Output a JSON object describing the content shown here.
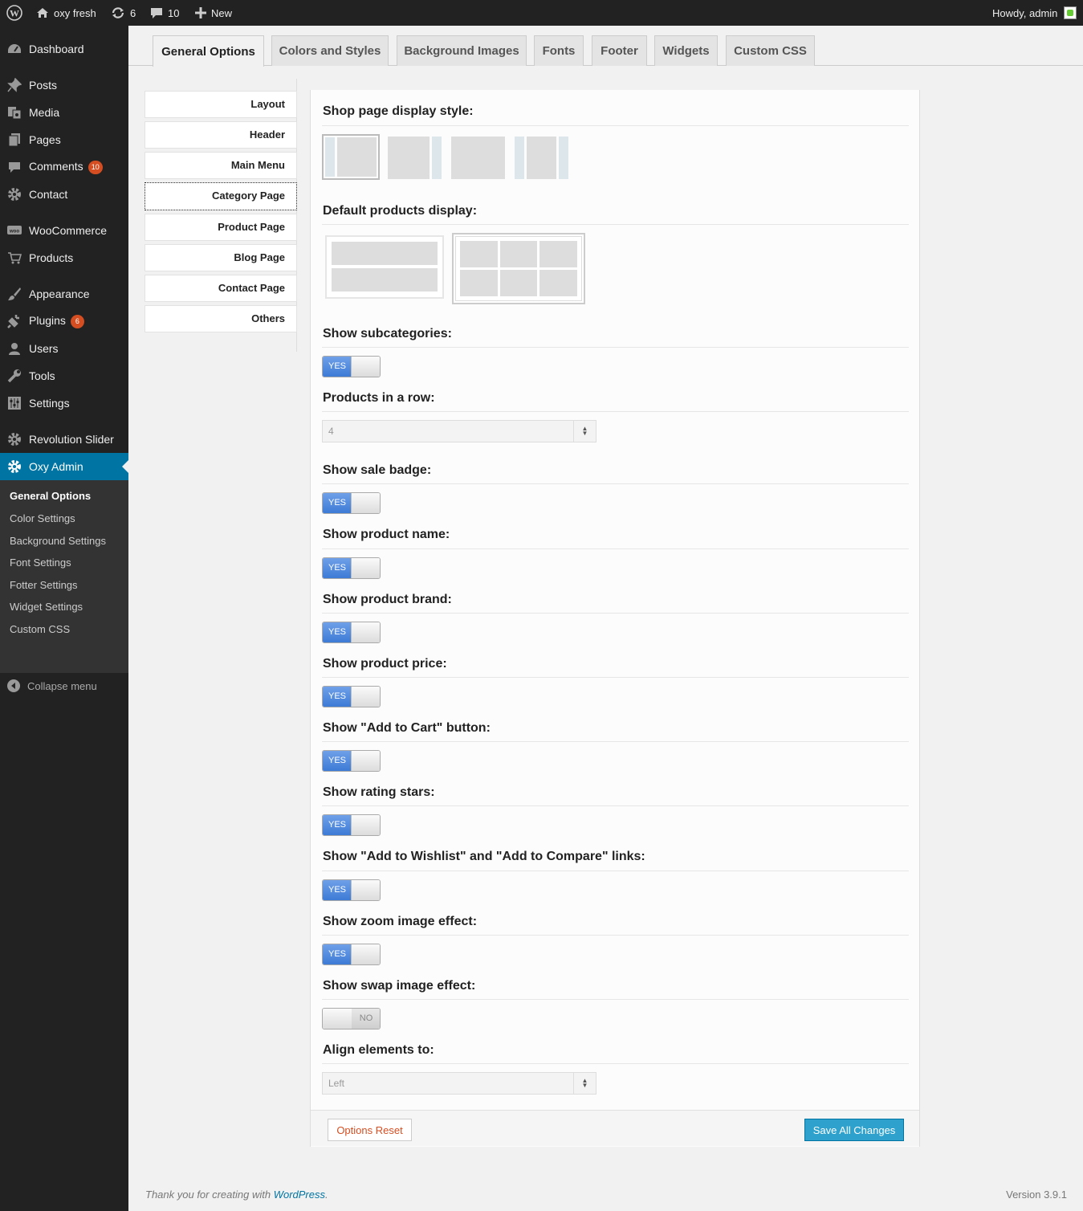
{
  "adminbar": {
    "site_name": "oxy fresh",
    "updates_count": "6",
    "comments_count": "10",
    "new_label": "New",
    "howdy": "Howdy, admin"
  },
  "menu": {
    "dashboard": "Dashboard",
    "posts": "Posts",
    "media": "Media",
    "pages": "Pages",
    "comments": "Comments",
    "comments_badge": "10",
    "contact": "Contact",
    "woocommerce": "WooCommerce",
    "products": "Products",
    "appearance": "Appearance",
    "plugins": "Plugins",
    "plugins_badge": "6",
    "users": "Users",
    "tools": "Tools",
    "settings": "Settings",
    "revolution_slider": "Revolution Slider",
    "oxy_admin": "Oxy Admin",
    "collapse": "Collapse menu"
  },
  "submenu": [
    "General Options",
    "Color Settings",
    "Background Settings",
    "Font Settings",
    "Fotter Settings",
    "Widget Settings",
    "Custom CSS"
  ],
  "tabs": [
    "General Options",
    "Colors and Styles",
    "Background Images",
    "Fonts",
    "Footer",
    "Widgets",
    "Custom CSS"
  ],
  "subnav": [
    "Layout",
    "Header",
    "Main Menu",
    "Category Page",
    "Product Page",
    "Blog Page",
    "Contact Page",
    "Others"
  ],
  "options": {
    "shop_display_style": "Shop page display style:",
    "default_products_display": "Default products display:",
    "show_subcategories": "Show subcategories:",
    "products_in_row": "Products in a row:",
    "products_in_row_value": "4",
    "show_sale_badge": "Show sale badge:",
    "show_product_name": "Show product name:",
    "show_product_brand": "Show product brand:",
    "show_product_price": "Show product price:",
    "show_add_to_cart": "Show \"Add to Cart\" button:",
    "show_rating_stars": "Show rating stars:",
    "show_wishlist_compare": "Show \"Add to Wishlist\" and \"Add to Compare\" links:",
    "show_zoom": "Show zoom image effect:",
    "show_swap": "Show swap image effect:",
    "align_elements": "Align elements to:",
    "align_value": "Left",
    "yes": "YES",
    "no": "NO"
  },
  "buttons": {
    "reset": "Options Reset",
    "save": "Save All Changes"
  },
  "footer": {
    "thanks": "Thank you for creating with ",
    "wp_link": "WordPress",
    "period": ".",
    "version": "Version 3.9.1"
  }
}
